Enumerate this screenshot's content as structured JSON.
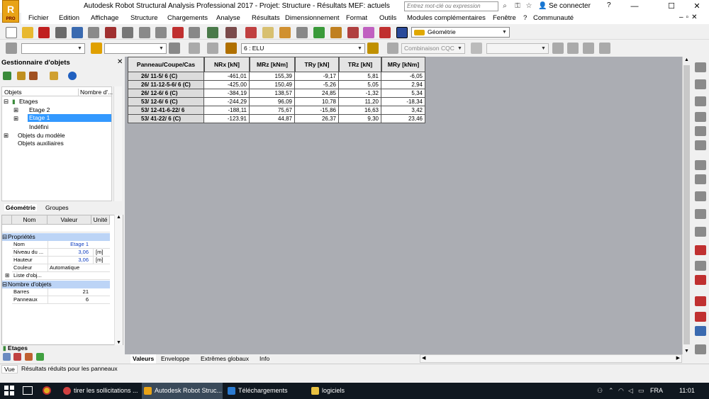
{
  "window": {
    "title": "Autodesk Robot Structural Analysis Professional 2017 - Projet: Structure - Résultats MEF: actuels",
    "logo": "R",
    "logo_sub": "PRO",
    "search_placeholder": "Entrez mot-clé ou expression",
    "login": "Se connecter",
    "help": "?",
    "minimize": "—",
    "maximize": "☐",
    "close": "✕"
  },
  "menu": [
    "Fichier",
    "Edition",
    "Affichage",
    "Structure",
    "Chargements",
    "Analyse",
    "Résultats",
    "Dimensionnement",
    "Format",
    "Outils",
    "Modules complémentaires",
    "Fenêtre",
    "?",
    "Communauté"
  ],
  "toolbar": {
    "view_combo": "Géométrie",
    "case_combo": "6 : ELU",
    "combination_combo": "Combinaison CQC"
  },
  "object_manager": {
    "title": "Gestionnaire d'objets",
    "col_objects": "Objets",
    "col_count": "Nombre d'...",
    "tree": [
      "Etages",
      "Etage 2",
      "Etage 1",
      "Indéfini",
      "Objets du modèle",
      "Objets auxiliaires"
    ],
    "tabs": [
      "Géométrie",
      "Groupes"
    ],
    "grid_headers": [
      "Nom",
      "Valeur",
      "Unité"
    ],
    "sections": [
      "Propriétés",
      "Nombre d'objets"
    ],
    "props": [
      {
        "name": "Nom",
        "value": "Etage 1",
        "unit": ""
      },
      {
        "name": "Niveau du ...",
        "value": "3,06",
        "unit": "[m]"
      },
      {
        "name": "Hauteur",
        "value": "3,06",
        "unit": "[m]"
      },
      {
        "name": "Couleur",
        "value": "Automatique",
        "unit": ""
      },
      {
        "name": "Liste d'obj...",
        "value": "",
        "unit": ""
      }
    ],
    "counts": [
      {
        "name": "Barres",
        "value": "21"
      },
      {
        "name": "Panneaux",
        "value": "6"
      }
    ],
    "bottom_tab": "Etages"
  },
  "results_table": {
    "headers": [
      "Panneau/Coupe/Cas",
      "NRx [kN]",
      "MRz [kNm]",
      "TRy [kN]",
      "TRz [kN]",
      "MRy [kNm]"
    ],
    "rows": [
      [
        "26/     11-5/  6 (C)",
        "-461,01",
        "155,39",
        "-9,17",
        "5,81",
        "-6,05"
      ],
      [
        "26/     11-12-5-6/  6 (C)",
        "-425,00",
        "150,49",
        "-5,26",
        "5,05",
        "2,94"
      ],
      [
        "26/     12-6/  6 (C)",
        "-384,19",
        "138,57",
        "24,85",
        "-1,32",
        "5,34"
      ],
      [
        "53/     12-6/  6 (C)",
        "-244,29",
        "96,09",
        "10,78",
        "11,20",
        "-18,34"
      ],
      [
        "53/     12-41-6-22/   6",
        "-188,11",
        "75,67",
        "-15,86",
        "16,63",
        "3,42"
      ],
      [
        "53/     41-22/       6 (C)",
        "-123,91",
        "44,87",
        "26,37",
        "9,30",
        "23,46"
      ]
    ]
  },
  "result_tabs": [
    "Valeurs",
    "Enveloppe",
    "Extrêmes globaux",
    "Info"
  ],
  "status": {
    "view": "Vue",
    "message": "Résultats réduits pour les panneaux"
  },
  "taskbar": {
    "items": [
      "tirer les sollicitations ...",
      "Autodesk Robot Struc...",
      "Téléchargements",
      "logiciels"
    ],
    "language": "FRA",
    "clock": "11:01"
  },
  "colors": {
    "accent": "#3399ff",
    "logo": "#e8a317",
    "taskbar": "#101820"
  }
}
